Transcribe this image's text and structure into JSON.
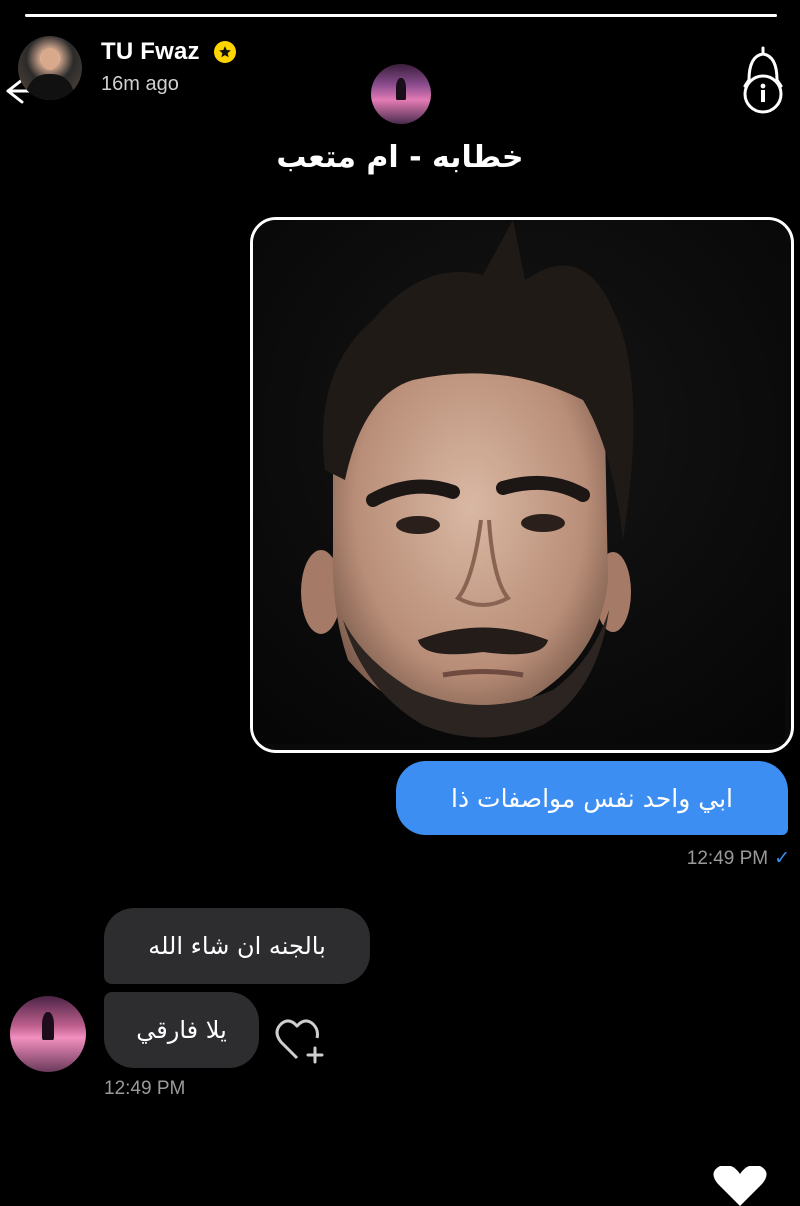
{
  "story": {
    "progress": 1.0,
    "user_name": "TU Fwaz",
    "time_ago": "16m ago",
    "verified": true,
    "accent": "#ffd500"
  },
  "chat": {
    "contact_name": "خطابه - ام متعب",
    "outgoing_message": "ابي واحد نفس مواصفات ذا",
    "outgoing_time": "12:49 PM",
    "incoming_messages": [
      "بالجنه ان شاء الله",
      "يلا فارقي"
    ],
    "incoming_time": "12:49 PM",
    "bubble_colors": {
      "outgoing": "#3d8ef2",
      "incoming": "#2d2d30"
    }
  },
  "icons": {
    "back": "arrow-left-icon",
    "verified": "star-badge-icon",
    "bell": "bell-info-icon",
    "heart_add": "heart-plus-icon",
    "heart": "heart-icon"
  }
}
